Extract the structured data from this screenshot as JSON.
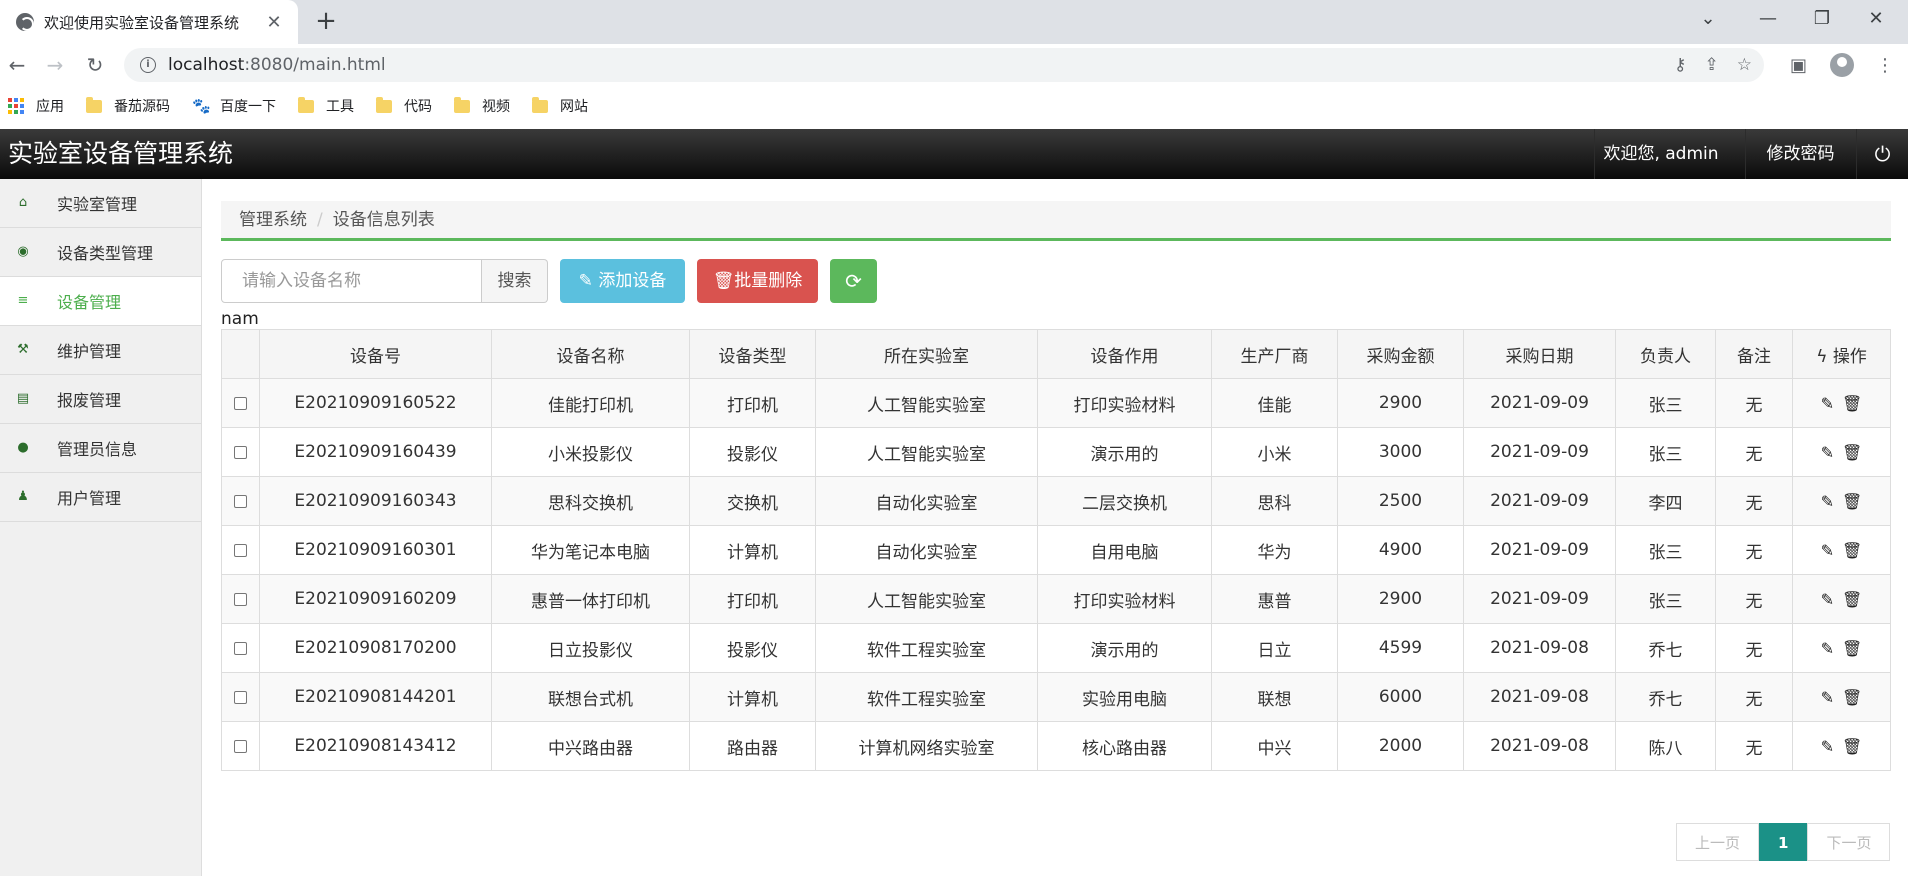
{
  "browser": {
    "tab_title": "欢迎使用实验室设备管理系统",
    "url_host": "localhost",
    "url_path": ":8080/main.html",
    "bookmarks": [
      "应用",
      "番茄源码",
      "百度一下",
      "工具",
      "代码",
      "视频",
      "网站"
    ]
  },
  "app": {
    "title": "实验室设备管理系统",
    "welcome": "欢迎您, admin",
    "change_password": "修改密码"
  },
  "sidebar": {
    "items": [
      {
        "label": "实验室管理",
        "icon": "home-icon"
      },
      {
        "label": "设备类型管理",
        "icon": "database-icon"
      },
      {
        "label": "设备管理",
        "icon": "list-icon"
      },
      {
        "label": "维护管理",
        "icon": "wrench-icon"
      },
      {
        "label": "报废管理",
        "icon": "archive-icon"
      },
      {
        "label": "管理员信息",
        "icon": "user-icon"
      },
      {
        "label": "用户管理",
        "icon": "user-tie-icon"
      }
    ],
    "active": 2
  },
  "breadcrumb": {
    "root": "管理系统",
    "current": "设备信息列表"
  },
  "toolbar": {
    "search_placeholder": "请输入设备名称",
    "search_label": "搜索",
    "add_label": "添加设备",
    "batch_delete_label": "批量删除"
  },
  "stray_text": "nam",
  "table": {
    "headers": [
      "设备号",
      "设备名称",
      "设备类型",
      "所在实验室",
      "设备作用",
      "生产厂商",
      "采购金额",
      "采购日期",
      "负责人",
      "备注",
      "操作"
    ],
    "rows": [
      [
        "E20210909160522",
        "佳能打印机",
        "打印机",
        "人工智能实验室",
        "打印实验材料",
        "佳能",
        "2900",
        "2021-09-09",
        "张三",
        "无"
      ],
      [
        "E20210909160439",
        "小米投影仪",
        "投影仪",
        "人工智能实验室",
        "演示用的",
        "小米",
        "3000",
        "2021-09-09",
        "张三",
        "无"
      ],
      [
        "E20210909160343",
        "思科交换机",
        "交换机",
        "自动化实验室",
        "二层交换机",
        "思科",
        "2500",
        "2021-09-09",
        "李四",
        "无"
      ],
      [
        "E20210909160301",
        "华为笔记本电脑",
        "计算机",
        "自动化实验室",
        "自用电脑",
        "华为",
        "4900",
        "2021-09-09",
        "张三",
        "无"
      ],
      [
        "E20210909160209",
        "惠普一体打印机",
        "打印机",
        "人工智能实验室",
        "打印实验材料",
        "惠普",
        "2900",
        "2021-09-09",
        "张三",
        "无"
      ],
      [
        "E20210908170200",
        "日立投影仪",
        "投影仪",
        "软件工程实验室",
        "演示用的",
        "日立",
        "4599",
        "2021-09-08",
        "乔七",
        "无"
      ],
      [
        "E20210908144201",
        "联想台式机",
        "计算机",
        "软件工程实验室",
        "实验用电脑",
        "联想",
        "6000",
        "2021-09-08",
        "乔七",
        "无"
      ],
      [
        "E20210908143412",
        "中兴路由器",
        "路由器",
        "计算机网络实验室",
        "核心路由器",
        "中兴",
        "2000",
        "2021-09-08",
        "陈八",
        "无"
      ]
    ]
  },
  "pagination": {
    "prev": "上一页",
    "current": "1",
    "next": "下一页"
  }
}
